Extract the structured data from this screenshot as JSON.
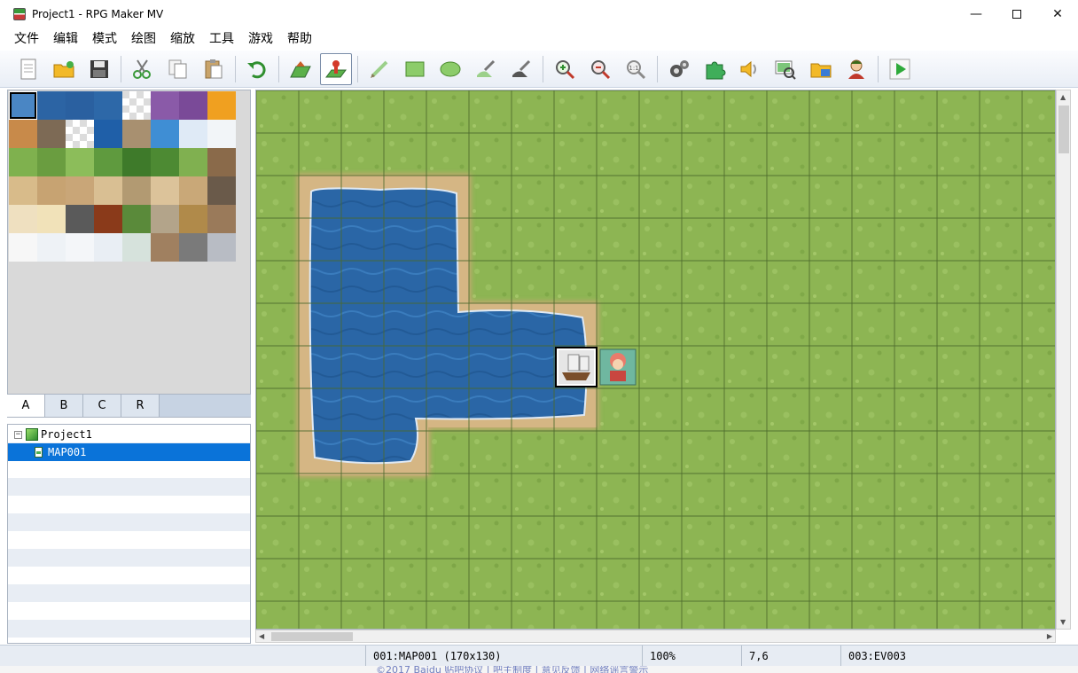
{
  "window": {
    "title": "Project1 - RPG Maker MV",
    "controls": [
      "minimize",
      "maximize",
      "close"
    ]
  },
  "menu": [
    "文件",
    "编辑",
    "模式",
    "绘图",
    "缩放",
    "工具",
    "游戏",
    "帮助"
  ],
  "toolbar": {
    "groups": [
      [
        "new-project-icon",
        "open-project-icon",
        "save-project-icon"
      ],
      [
        "cut-icon",
        "copy-icon",
        "paste-icon"
      ],
      [
        "undo-icon"
      ],
      [
        "map-mode-icon",
        "event-mode-icon"
      ],
      [
        "pencil-icon",
        "rectangle-icon",
        "ellipse-icon",
        "flood-fill-icon",
        "shadow-pen-icon"
      ],
      [
        "zoom-in-icon",
        "zoom-out-icon",
        "actual-size-icon"
      ],
      [
        "database-icon",
        "plugin-manager-icon",
        "sound-test-icon",
        "event-searcher-icon",
        "resource-manager-icon",
        "character-generator-icon"
      ],
      [
        "playtest-icon"
      ]
    ],
    "active": "event-mode-icon"
  },
  "tileset": {
    "selected_index": 0,
    "tiles": [
      "water-shallow",
      "water-deep",
      "water-deep2",
      "water-deep3",
      "checker",
      "purple-poison",
      "purple-bramble",
      "lava",
      "lava-rock",
      "rock-island",
      "checker",
      "whirlpool",
      "rock-spot",
      "waterfall",
      "ice-rock",
      "cloud",
      "grass",
      "grass-dark",
      "grass-light",
      "grass-deep",
      "tree",
      "tree-small",
      "hill-green",
      "mountain-brown",
      "sand",
      "sand-dark",
      "dirt",
      "dirt-light",
      "dead-tree",
      "sand-round",
      "hill-sand",
      "mountain-dark",
      "desert",
      "desert-light",
      "rock-gray",
      "lava-dark",
      "palm-tree",
      "star-rock",
      "mountain-gold",
      "mountain-tan",
      "snow",
      "snow-field",
      "snow-light",
      "snow-cloud",
      "pine-snow",
      "crater",
      "mountain-gray",
      "mountain-snow"
    ]
  },
  "tabs": [
    "A",
    "B",
    "C",
    "R"
  ],
  "active_tab": "A",
  "tree": {
    "items": [
      {
        "label": "Project1",
        "kind": "project",
        "expander": "⊟"
      },
      {
        "label": "MAP001",
        "kind": "map",
        "selected": true
      }
    ]
  },
  "colors": {
    "grass": "#8bb34f",
    "grid": "#4d6a2e",
    "water": "#2a6aa8",
    "sand": "#d2b17c",
    "selection": "#0a73d9"
  },
  "status": {
    "map": "001:MAP001 (170x130)",
    "zoom": "100%",
    "coords": "7,6",
    "event": "003:EV003"
  },
  "footer_text": "©2017 Baidu 贴吧协议 | 吧主制度 | 意见反馈 | 网络谣言警示"
}
